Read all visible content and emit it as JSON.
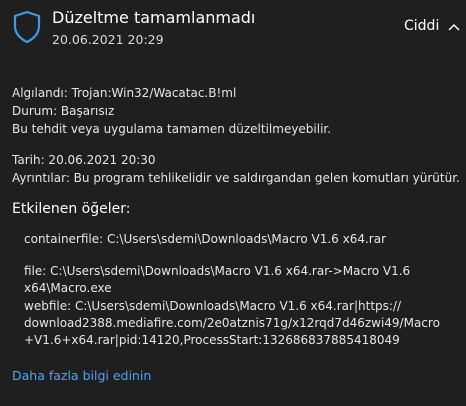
{
  "header": {
    "title": "Düzeltme tamamlanmadı",
    "datetime": "20.06.2021 20:29",
    "severity": "Ciddi",
    "shield_color": "#3a9be8"
  },
  "details": {
    "detected": "Algılandı:  Trojan:Win32/Wacatac.B!ml",
    "status": "Durum:  Başarısız",
    "note": "Bu tehdit veya uygulama tamamen düzeltilmeyebilir.",
    "date": "Tarih:  20.06.2021 20:30",
    "info": "Ayrıntılar: Bu program tehlikelidir ve saldırgandan gelen komutları yürütür."
  },
  "affected": {
    "heading": "Etkilenen öğeler:",
    "items": [
      "containerfile: C:\\Users\\sdemi\\Downloads\\Macro V1.6 x64.rar",
      "file: C:\\Users\\sdemi\\Downloads\\Macro V1.6 x64.rar->Macro V1.6\nx64\\Macro.exe",
      "webfile: C:\\Users\\sdemi\\Downloads\\Macro V1.6 x64.rar|https://\ndownload2388.mediafire.com/2e0atznis71g/x12rqd7d46zwi49/Macro\n+V1.6+x64.rar|pid:14120,ProcessStart:132686837885418049"
    ]
  },
  "more_link": "Daha fazla bilgi edinin",
  "link_color": "#4aa3ff"
}
